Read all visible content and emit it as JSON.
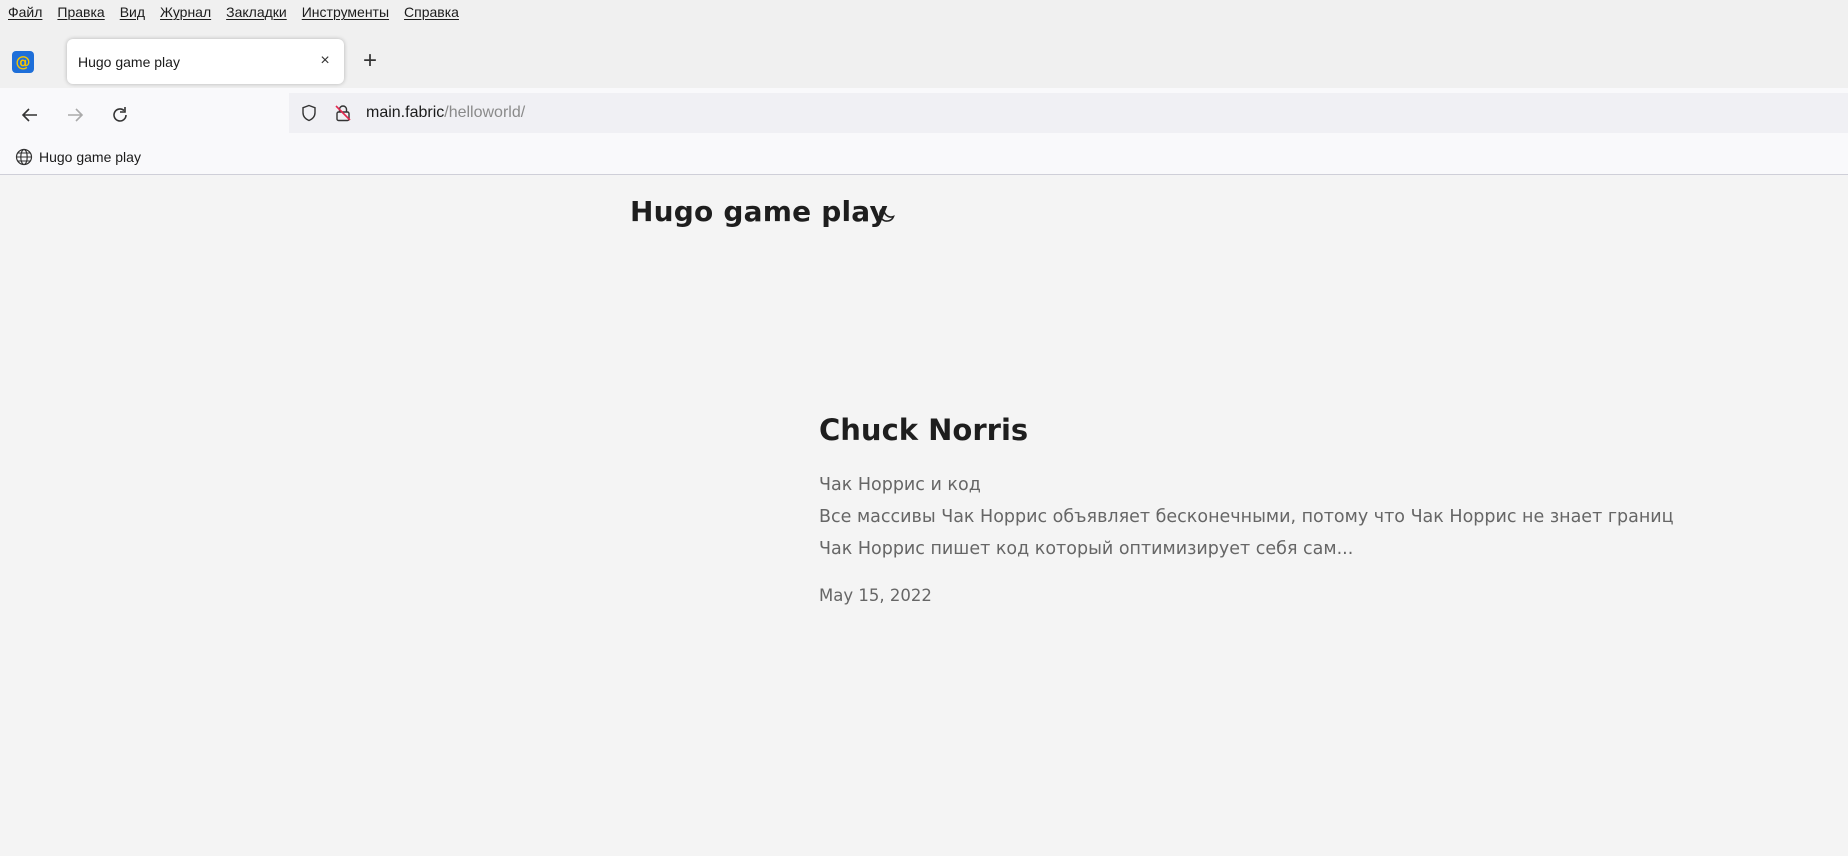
{
  "menu": [
    "Файл",
    "Правка",
    "Вид",
    "Журнал",
    "Закладки",
    "Инструменты",
    "Справка"
  ],
  "tabs": {
    "pinned_icon": "mail-at-icon",
    "active_title": "Hugo game play",
    "new_tab_symbol": "+",
    "close_symbol": "×"
  },
  "address": {
    "host": "main.fabric",
    "path": "/helloworld/"
  },
  "bookmarks": [
    {
      "label": "Hugo game play",
      "icon": "globe-icon"
    }
  ],
  "site": {
    "title": "Hugo game play",
    "theme_icon": "moon-icon"
  },
  "post": {
    "title": "Chuck Norris",
    "summary": [
      "Чак Норрис и код",
      "Все массивы Чак Норрис объявляет бесконечными, потому что Чак Норрис не знает границ",
      "Чак Норрис пишет код который оптимизирует себя сам..."
    ],
    "date": "May 15, 2022"
  }
}
